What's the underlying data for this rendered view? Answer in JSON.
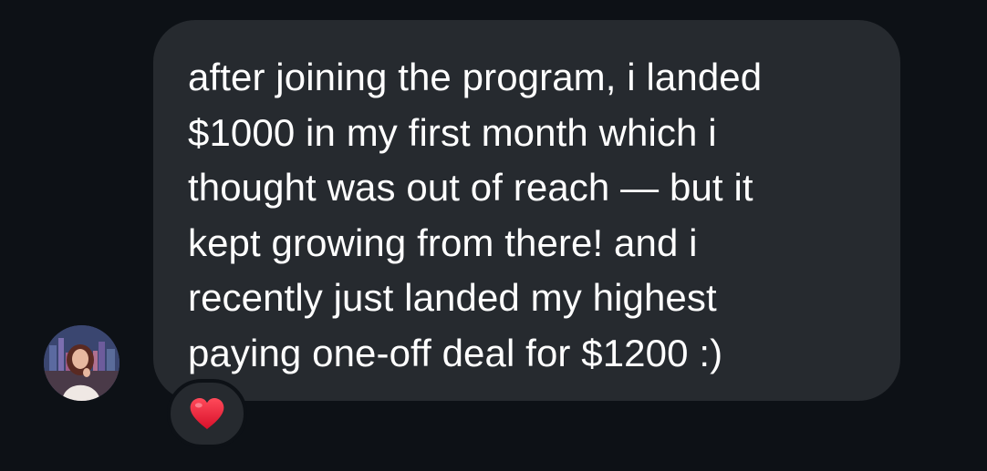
{
  "message": {
    "text": "after joining the program, i landed\n$1000 in my first month which i\nthought was out of reach — but it\nkept growing from there! and i\nrecently just landed my highest\npaying one-off deal for $1200 :)",
    "reaction": "heart"
  },
  "colors": {
    "background": "#0d1116",
    "bubble": "#262a2f",
    "text": "#ffffff",
    "heart": "#e8172d"
  },
  "icons": {
    "avatar": "sender-avatar-photo",
    "reaction": "red-heart-icon"
  }
}
